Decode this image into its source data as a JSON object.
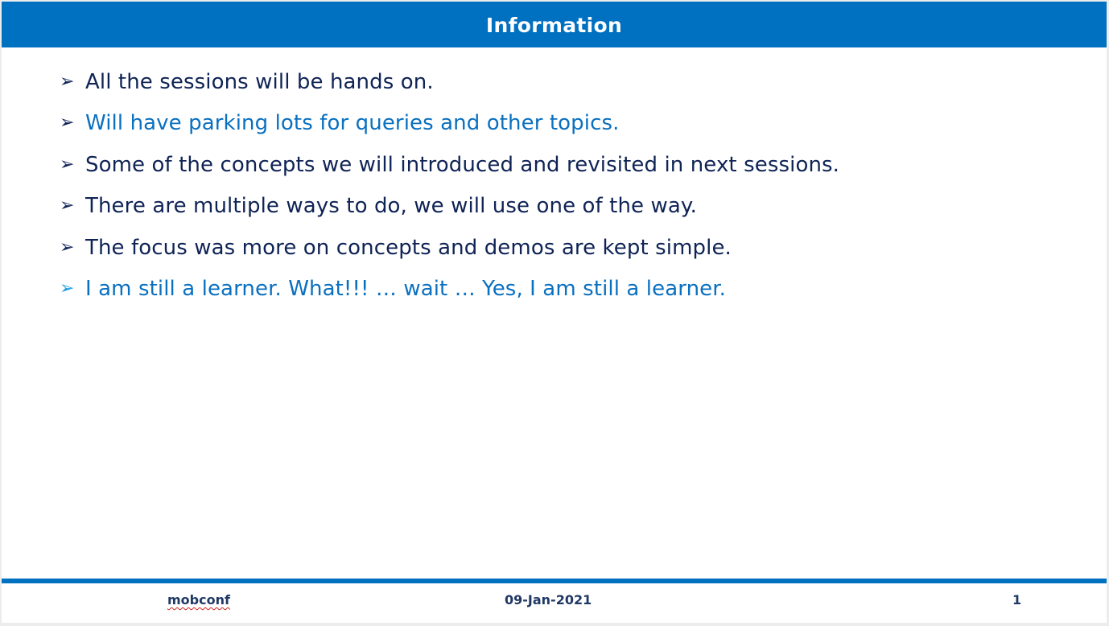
{
  "slide": {
    "title": "Information",
    "colors": {
      "header_background": "#0070c0",
      "header_text": "#ffffff",
      "dark_text": "#0f2355",
      "accent_text": "#0a70c0",
      "accent_arrow": "#1a9ee0",
      "footer_text": "#1f3864"
    },
    "bullet_icon": "arrow-right-icon",
    "bullet_glyph": "➢",
    "bullets": [
      {
        "text": "All the sessions will be hands on.",
        "color": "#0f2355",
        "arrow_color": "#0f2355"
      },
      {
        "text": "Will have parking lots for queries and other topics.",
        "color": "#0a70c0",
        "arrow_color": "#0f2355"
      },
      {
        "text": "Some of the concepts we will introduced and revisited in next sessions.",
        "color": "#0f2355",
        "arrow_color": "#0f2355"
      },
      {
        "text": "There are multiple ways to do, we will use one of the way.",
        "color": "#0f2355",
        "arrow_color": "#0f2355"
      },
      {
        "text": "The focus was more on concepts and demos are kept simple.",
        "color": "#0f2355",
        "arrow_color": "#0f2355"
      },
      {
        "text": "I am still a learner. What!!! … wait … Yes, I am still a learner.",
        "color": "#0a70c0",
        "arrow_color": "#1a9ee0"
      }
    ],
    "footer": {
      "left": "mobconf",
      "center": "09-Jan-2021",
      "right": "1"
    }
  }
}
